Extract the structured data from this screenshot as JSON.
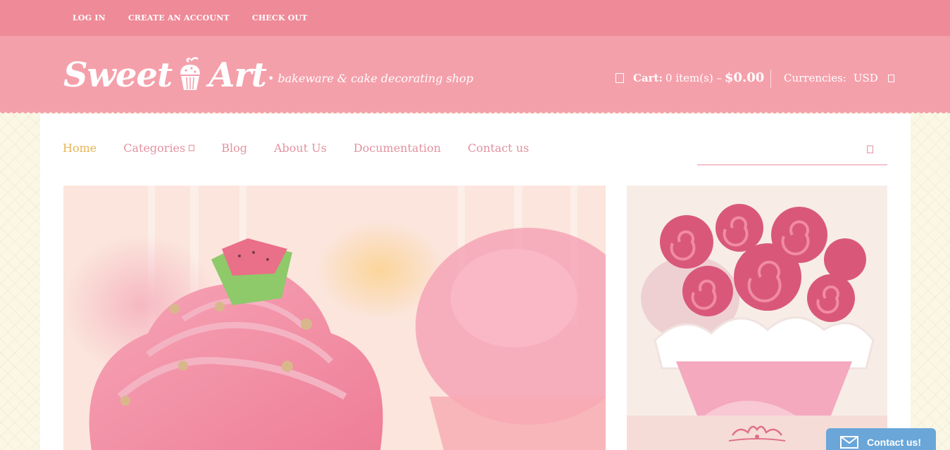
{
  "topbar": {
    "links": [
      "LOG IN",
      "CREATE AN ACCOUNT",
      "CHECK OUT"
    ]
  },
  "header": {
    "logo_word1": "Sweet",
    "logo_word2": "Art",
    "tagline": "• bakeware & cake decorating shop",
    "cart_label": "Cart:",
    "cart_items": "0 item(s) –",
    "cart_total": "$0.00",
    "currency_label": "Currencies:",
    "currency_value": "USD"
  },
  "nav": {
    "items": [
      {
        "label": "Home",
        "active": true
      },
      {
        "label": "Categories",
        "active": false
      },
      {
        "label": "Blog",
        "active": false
      },
      {
        "label": "About Us",
        "active": false
      },
      {
        "label": "Documentation",
        "active": false
      },
      {
        "label": "Contact us",
        "active": false
      }
    ]
  },
  "search": {
    "placeholder": "",
    "icon": "search-icon"
  },
  "contact_widget": {
    "label": "Contact us!",
    "icon": "mail-icon"
  },
  "colors": {
    "topbar": "#ef8a98",
    "header": "#f4a0ab",
    "nav_link": "#e3929f",
    "nav_active": "#e8b453",
    "contact_button": "#6aa6d8"
  }
}
